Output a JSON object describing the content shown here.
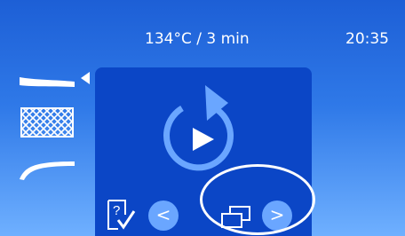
{
  "header": {
    "program": "134°C / 3 min",
    "time": "20:35"
  },
  "sidebar": {
    "items": [
      {
        "icon": "straight-instrument-icon"
      },
      {
        "icon": "mesh-tray-icon"
      },
      {
        "icon": "curved-instrument-icon"
      }
    ],
    "selected_index": 0
  },
  "main": {
    "cycle_icon": "cycle-play-icon"
  },
  "controls": {
    "help_icon": "help-check-icon",
    "prev_label": "<",
    "next_label": ">",
    "windows_icon": "windows-icon"
  },
  "colors": {
    "panel": "#0b46c6",
    "button": "#6aa6ff",
    "accent": "#ffffff"
  }
}
